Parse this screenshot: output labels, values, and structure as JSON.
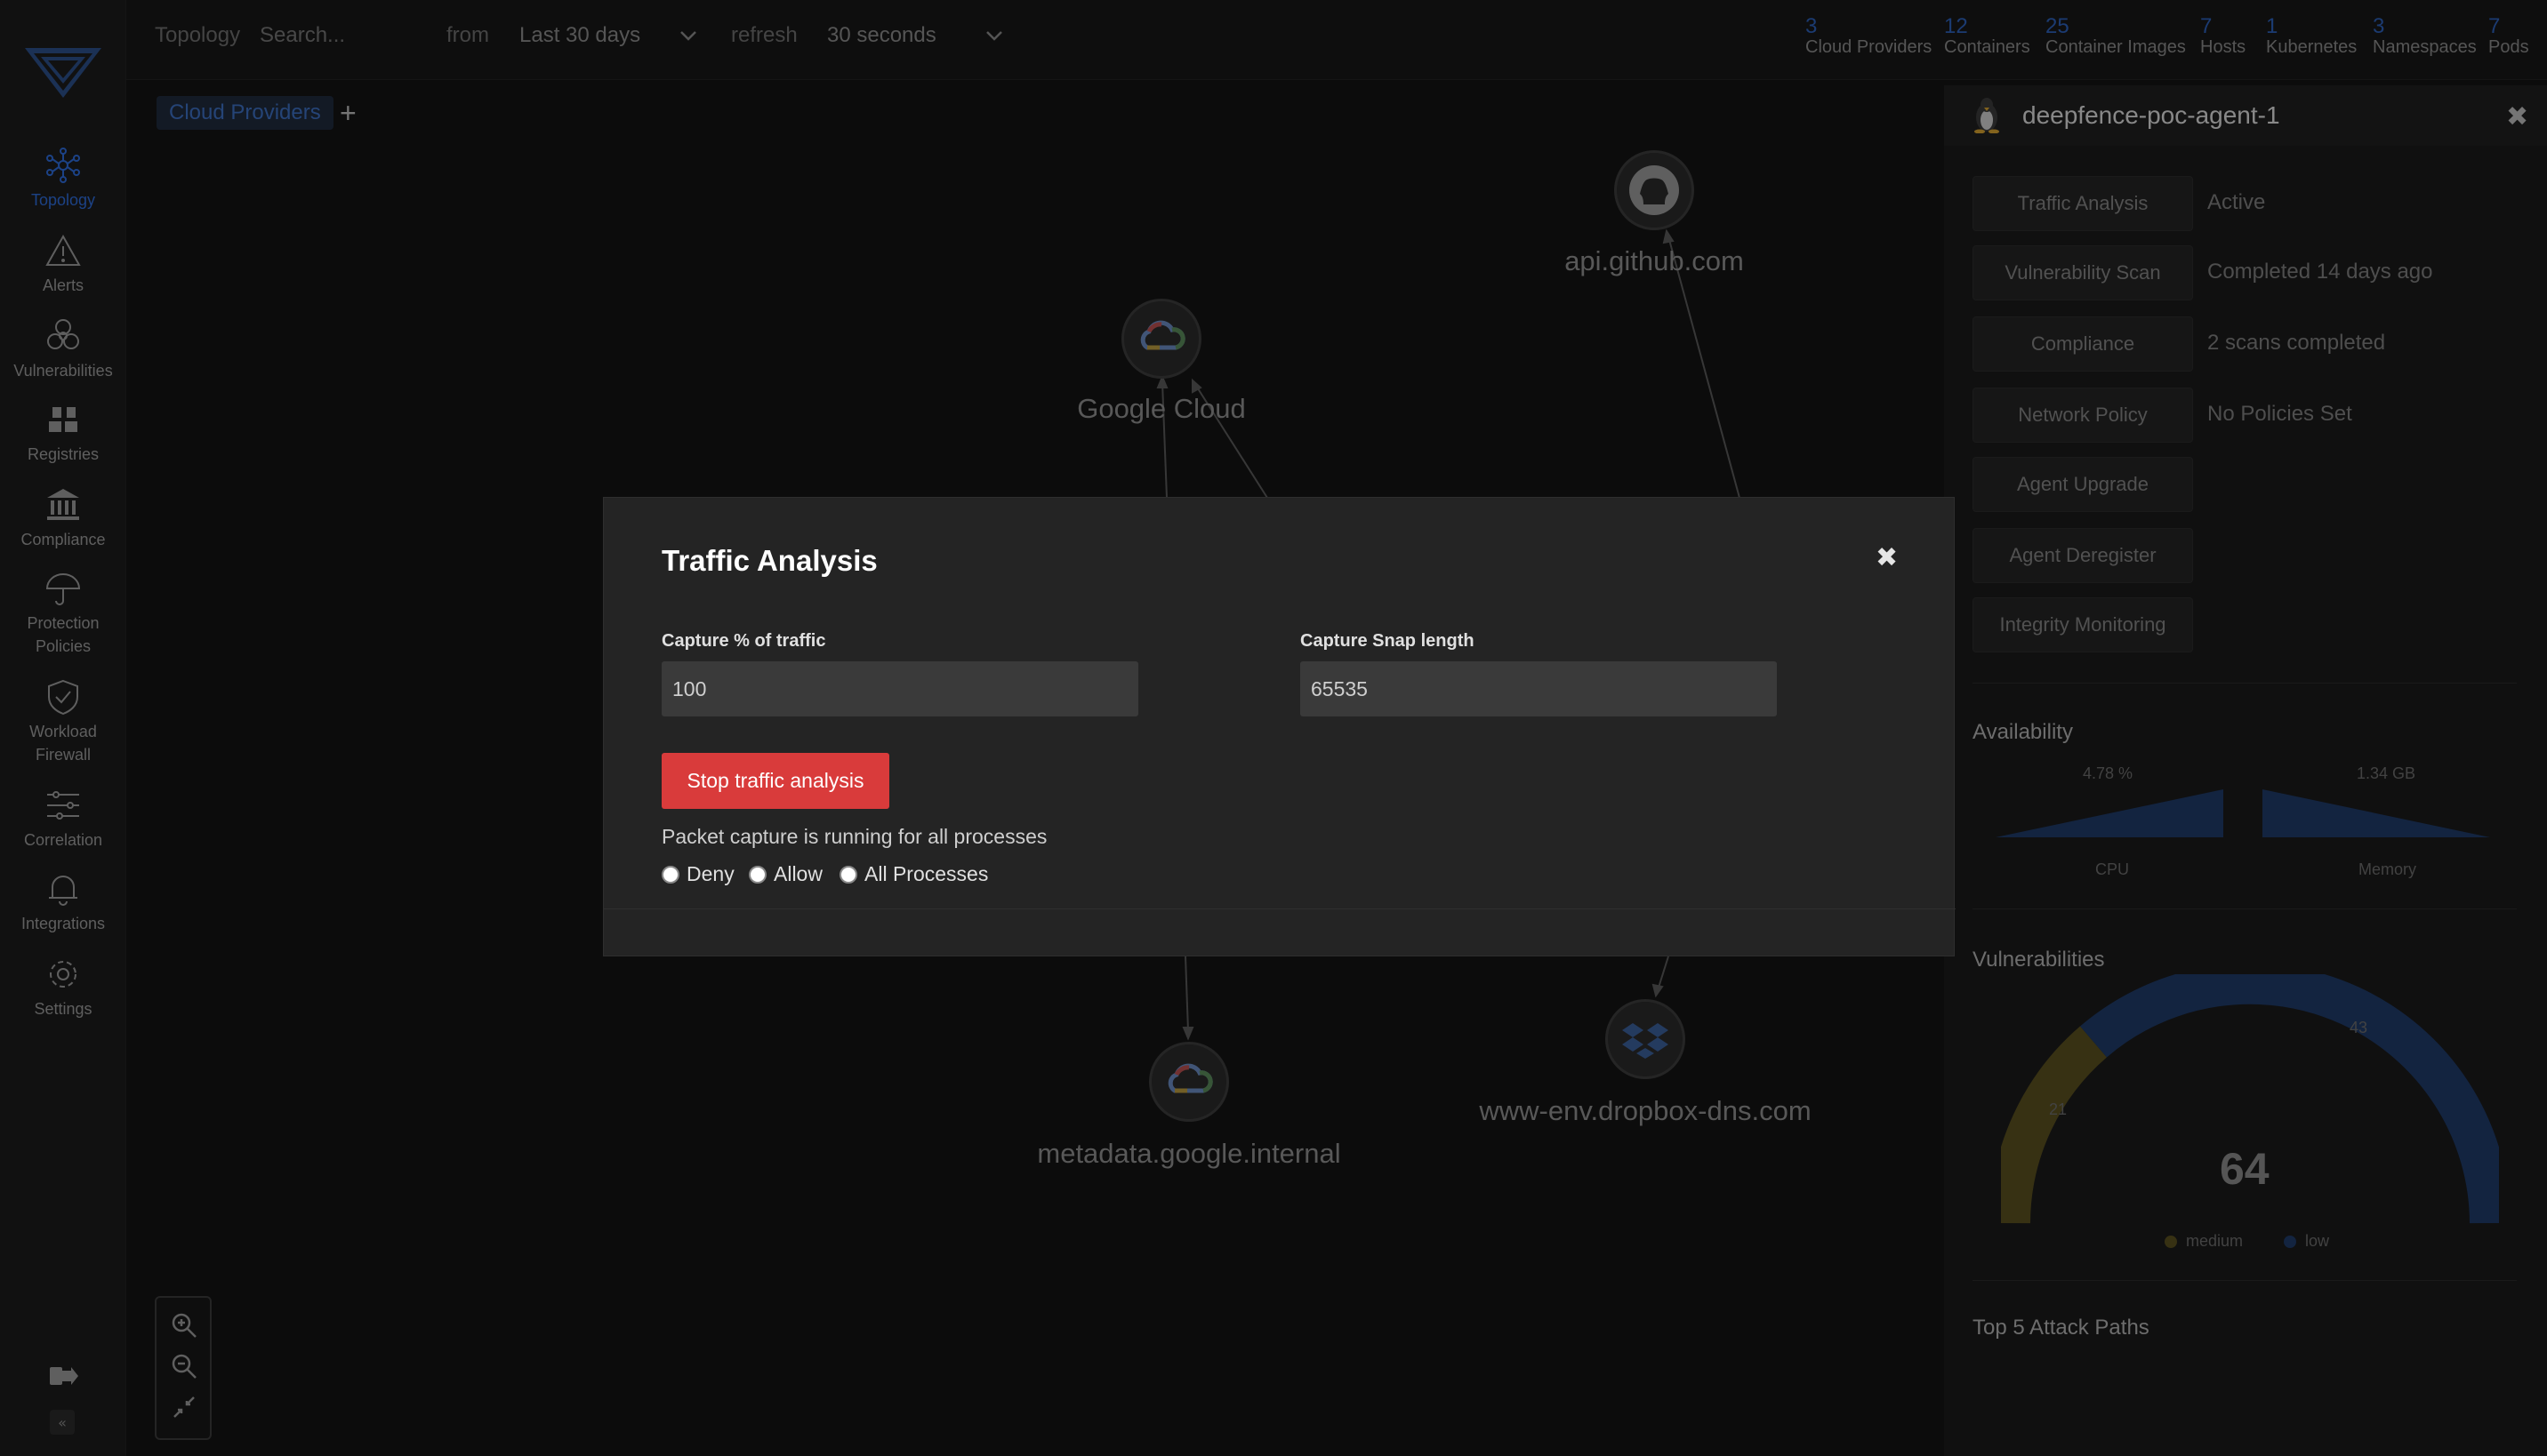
{
  "topbar": {
    "section": "Topology",
    "search_placeholder": "Search...",
    "from_label": "from",
    "range_value": "Last 30 days",
    "refresh_label": "refresh",
    "refresh_value": "30 seconds",
    "stats": [
      {
        "count": "3",
        "label": "Cloud Providers"
      },
      {
        "count": "12",
        "label": "Containers"
      },
      {
        "count": "25",
        "label": "Container Images"
      },
      {
        "count": "7",
        "label": "Hosts"
      },
      {
        "count": "1",
        "label": "Kubernetes"
      },
      {
        "count": "3",
        "label": "Namespaces"
      },
      {
        "count": "7",
        "label": "Pods"
      }
    ]
  },
  "sidebar": {
    "items": [
      {
        "label": "Topology",
        "icon": "topology-icon"
      },
      {
        "label": "Alerts",
        "icon": "alert-triangle-icon"
      },
      {
        "label": "Vulnerabilities",
        "icon": "biohazard-icon"
      },
      {
        "label": "Registries",
        "icon": "registries-icon"
      },
      {
        "label": "Compliance",
        "icon": "bank-icon"
      },
      {
        "label": "Protection Policies",
        "icon": "umbrella-icon"
      },
      {
        "label": "Workload Firewall",
        "icon": "shield-check-icon"
      },
      {
        "label": "Correlation",
        "icon": "sliders-icon"
      },
      {
        "label": "Integrations",
        "icon": "bell-icon"
      },
      {
        "label": "Settings",
        "icon": "gear-icon"
      }
    ]
  },
  "topology": {
    "breadcrumb_chip": "Cloud Providers",
    "add_symbol": "+",
    "nodes": [
      {
        "label": "api.github.com",
        "icon": "github-icon"
      },
      {
        "label": "Google Cloud",
        "icon": "google-cloud-icon"
      },
      {
        "label": "metadata.google.internal",
        "icon": "google-cloud-icon"
      },
      {
        "label": "www-env.dropbox-dns.com",
        "icon": "dropbox-icon"
      }
    ]
  },
  "panel": {
    "title": "deepfence-poc-agent-1",
    "close": "✖",
    "actions": [
      {
        "label": "Traffic Analysis",
        "value": "Active"
      },
      {
        "label": "Vulnerability Scan",
        "value": "Completed 14 days ago"
      },
      {
        "label": "Compliance",
        "value": "2 scans completed"
      },
      {
        "label": "Network Policy",
        "value": "No Policies Set"
      },
      {
        "label": "Agent Upgrade",
        "value": ""
      },
      {
        "label": "Agent Deregister",
        "value": ""
      },
      {
        "label": "Integrity Monitoring",
        "value": ""
      }
    ],
    "availability": {
      "title": "Availability",
      "cpu_value": "4.78 %",
      "cpu_label": "CPU",
      "memory_value": "1.34 GB",
      "memory_label": "Memory"
    },
    "vulnerabilities": {
      "title": "Vulnerabilities",
      "total": "64",
      "medium_count": "21",
      "low_count": "43",
      "legend_medium": "medium",
      "legend_low": "low",
      "medium_color": "#b59a2a",
      "low_color": "#2d5fb8"
    },
    "attack_paths_title": "Top 5 Attack Paths"
  },
  "modal": {
    "title": "Traffic Analysis",
    "close": "✖",
    "capture_pct_label": "Capture % of traffic",
    "capture_pct_value": "100",
    "snap_len_label": "Capture Snap length",
    "snap_len_value": "65535",
    "stop_button": "Stop traffic analysis",
    "status_text": "Packet capture is running for all processes",
    "radio_options": [
      "Deny",
      "Allow",
      "All Processes"
    ]
  },
  "colors": {
    "accent": "#2e6bd9",
    "danger": "#d93b3b"
  }
}
